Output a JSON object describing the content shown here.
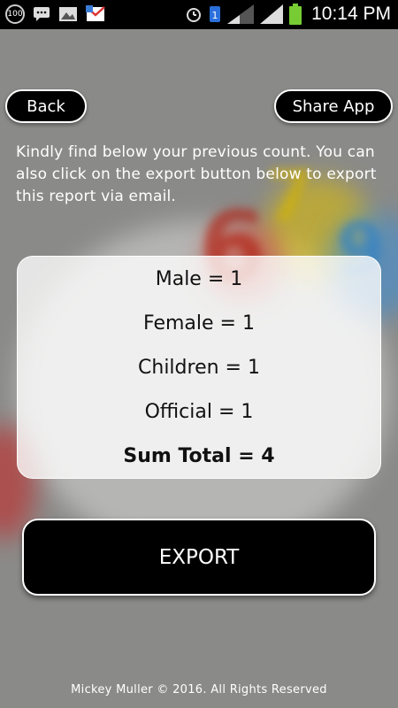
{
  "status_bar": {
    "notification_count": "100",
    "time": "10:14 PM",
    "left_icons": [
      "notification-count-icon",
      "chat-icon",
      "image-icon",
      "gmail-icon"
    ],
    "right_icons": [
      "alarm-icon",
      "sim-1-icon",
      "signal-icon",
      "signal-icon",
      "battery-icon"
    ]
  },
  "header": {
    "back_label": "Back",
    "share_label": "Share App"
  },
  "intro_text": "Kindly find below your previous count. You can also click on the export button below to export this report via email.",
  "counts": {
    "male": "Male = 1",
    "female": "Female = 1",
    "children": "Children = 1",
    "official": "Official = 1",
    "total": "Sum Total = 4"
  },
  "export_label": "EXPORT",
  "footer_text": "Mickey Muller © 2016. All Rights Reserved",
  "colors": {
    "background": "#8a8a88",
    "button_bg": "#000000",
    "button_border": "#ffffff",
    "card_bg": "#ffffff"
  }
}
